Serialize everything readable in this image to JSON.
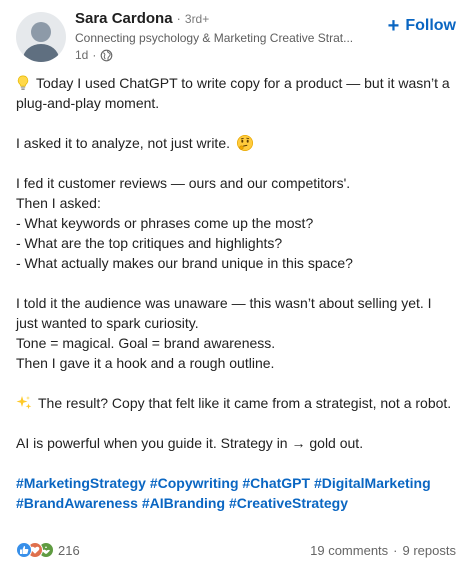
{
  "author": {
    "name": "Sara Cardona",
    "degree": "3rd+",
    "headline": "Connecting psychology & Marketing Creative Strat...",
    "time": "1d",
    "visibility_icon": "globe-icon"
  },
  "follow_button": {
    "label": "Follow",
    "icon": "plus-icon"
  },
  "post": {
    "line1": "Today I used ChatGPT to write copy for a product — but it wasn’t a plug-and-play moment.",
    "line1_icon": "lightbulb-emoji",
    "line2": "I asked it to analyze, not just write.",
    "line2_icon": "thinking-face-emoji",
    "line3": "I fed it customer reviews — ours and our competitors'.",
    "line4": "Then I asked:",
    "line5": "- What keywords or phrases come up the most?",
    "line6": "- What are the top critiques and highlights?",
    "line7": "- What actually makes our brand unique in this space?",
    "line8": "I told it the audience was unaware — this wasn’t about selling yet. I just wanted to spark curiosity.",
    "line9": "Tone = magical. Goal = brand awareness.",
    "line10": "Then I gave it a hook and a rough outline.",
    "line11": "The result? Copy that felt like it came from a strategist, not a robot.",
    "line11_icon": "sparkles-emoji",
    "line12": "AI is powerful when you guide it. Strategy in → gold out."
  },
  "hashtags": [
    "#MarketingStrategy",
    "#Copywriting",
    "#ChatGPT",
    "#DigitalMarketing",
    "#BrandAwareness",
    "#AIBranding",
    "#CreativeStrategy"
  ],
  "footer": {
    "reaction_icons": [
      "like-icon",
      "love-icon",
      "support-icon"
    ],
    "reaction_count": "216",
    "comments": "19 comments",
    "reposts": "9 reposts",
    "separator": "·"
  },
  "colors": {
    "link_blue": "#0a66c2",
    "like": "#378fe9",
    "love": "#df704d",
    "support": "#5f9b41"
  }
}
